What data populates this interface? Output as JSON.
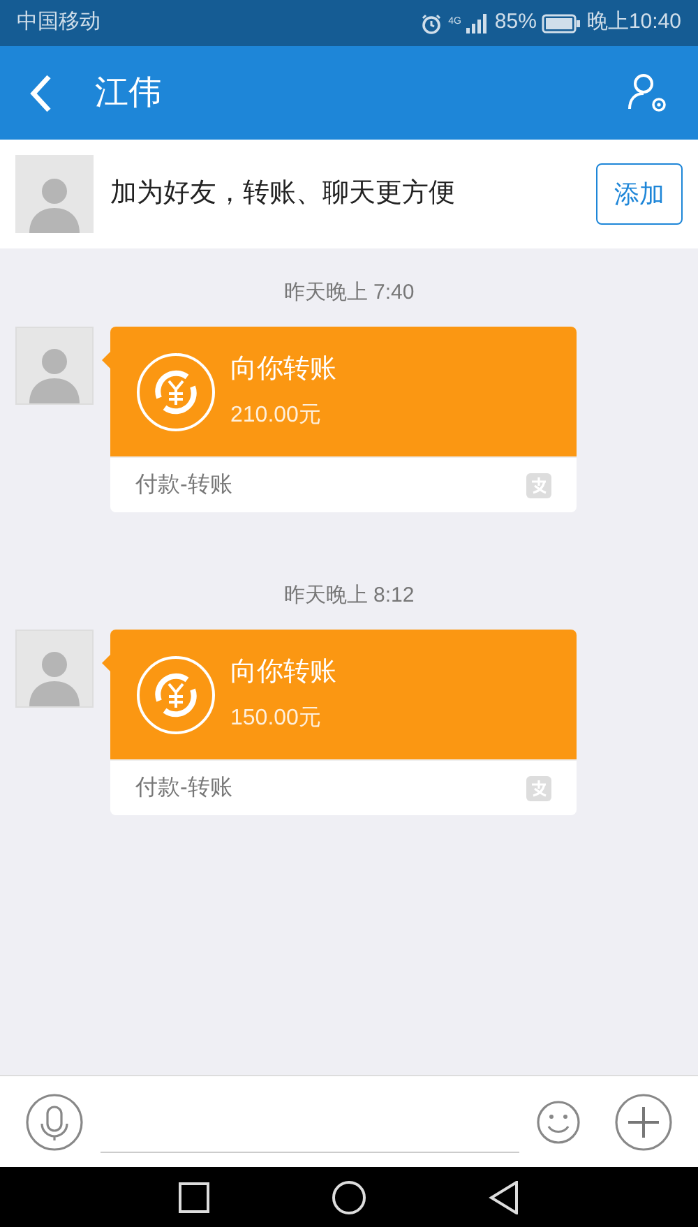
{
  "status_bar": {
    "carrier": "中国移动",
    "network": "4G",
    "battery": "85%",
    "time": "晚上10:40"
  },
  "header": {
    "title": "江伟"
  },
  "banner": {
    "text": "加为好友，转账、聊天更方便",
    "button": "添加"
  },
  "messages": [
    {
      "time": "昨天晚上 7:40",
      "kind": "transfer",
      "title": "向你转账",
      "amount": "210.00元",
      "footer": "付款-转账"
    },
    {
      "time": "昨天晚上 8:12",
      "kind": "transfer",
      "title": "向你转账",
      "amount": "150.00元",
      "footer": "付款-转账"
    }
  ]
}
